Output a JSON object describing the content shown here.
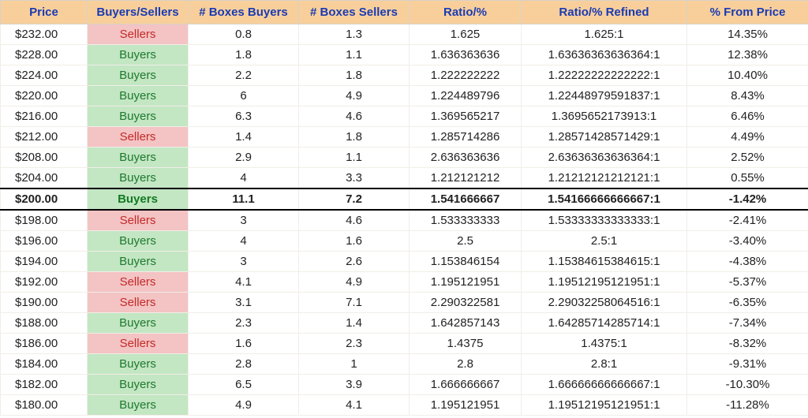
{
  "headers": {
    "price": "Price",
    "buyers_sellers": "Buyers/Sellers",
    "boxes_buyers": "# Boxes Buyers",
    "boxes_sellers": "# Boxes Sellers",
    "ratio": "Ratio/%",
    "ratio_refined": "Ratio/% Refined",
    "from_price": "% From Price"
  },
  "rows": [
    {
      "price": "$232.00",
      "side": "Sellers",
      "boxes_buyers": "0.8",
      "boxes_sellers": "1.3",
      "ratio": "1.625",
      "ratio_refined": "1.625:1",
      "from_price": "14.35%",
      "highlight": false
    },
    {
      "price": "$228.00",
      "side": "Buyers",
      "boxes_buyers": "1.8",
      "boxes_sellers": "1.1",
      "ratio": "1.636363636",
      "ratio_refined": "1.63636363636364:1",
      "from_price": "12.38%",
      "highlight": false
    },
    {
      "price": "$224.00",
      "side": "Buyers",
      "boxes_buyers": "2.2",
      "boxes_sellers": "1.8",
      "ratio": "1.222222222",
      "ratio_refined": "1.22222222222222:1",
      "from_price": "10.40%",
      "highlight": false
    },
    {
      "price": "$220.00",
      "side": "Buyers",
      "boxes_buyers": "6",
      "boxes_sellers": "4.9",
      "ratio": "1.224489796",
      "ratio_refined": "1.22448979591837:1",
      "from_price": "8.43%",
      "highlight": false
    },
    {
      "price": "$216.00",
      "side": "Buyers",
      "boxes_buyers": "6.3",
      "boxes_sellers": "4.6",
      "ratio": "1.369565217",
      "ratio_refined": "1.3695652173913:1",
      "from_price": "6.46%",
      "highlight": false
    },
    {
      "price": "$212.00",
      "side": "Sellers",
      "boxes_buyers": "1.4",
      "boxes_sellers": "1.8",
      "ratio": "1.285714286",
      "ratio_refined": "1.28571428571429:1",
      "from_price": "4.49%",
      "highlight": false
    },
    {
      "price": "$208.00",
      "side": "Buyers",
      "boxes_buyers": "2.9",
      "boxes_sellers": "1.1",
      "ratio": "2.636363636",
      "ratio_refined": "2.63636363636364:1",
      "from_price": "2.52%",
      "highlight": false
    },
    {
      "price": "$204.00",
      "side": "Buyers",
      "boxes_buyers": "4",
      "boxes_sellers": "3.3",
      "ratio": "1.212121212",
      "ratio_refined": "1.21212121212121:1",
      "from_price": "0.55%",
      "highlight": false
    },
    {
      "price": "$200.00",
      "side": "Buyers",
      "boxes_buyers": "11.1",
      "boxes_sellers": "7.2",
      "ratio": "1.541666667",
      "ratio_refined": "1.54166666666667:1",
      "from_price": "-1.42%",
      "highlight": true
    },
    {
      "price": "$198.00",
      "side": "Sellers",
      "boxes_buyers": "3",
      "boxes_sellers": "4.6",
      "ratio": "1.533333333",
      "ratio_refined": "1.53333333333333:1",
      "from_price": "-2.41%",
      "highlight": false
    },
    {
      "price": "$196.00",
      "side": "Buyers",
      "boxes_buyers": "4",
      "boxes_sellers": "1.6",
      "ratio": "2.5",
      "ratio_refined": "2.5:1",
      "from_price": "-3.40%",
      "highlight": false
    },
    {
      "price": "$194.00",
      "side": "Buyers",
      "boxes_buyers": "3",
      "boxes_sellers": "2.6",
      "ratio": "1.153846154",
      "ratio_refined": "1.15384615384615:1",
      "from_price": "-4.38%",
      "highlight": false
    },
    {
      "price": "$192.00",
      "side": "Sellers",
      "boxes_buyers": "4.1",
      "boxes_sellers": "4.9",
      "ratio": "1.195121951",
      "ratio_refined": "1.19512195121951:1",
      "from_price": "-5.37%",
      "highlight": false
    },
    {
      "price": "$190.00",
      "side": "Sellers",
      "boxes_buyers": "3.1",
      "boxes_sellers": "7.1",
      "ratio": "2.290322581",
      "ratio_refined": "2.29032258064516:1",
      "from_price": "-6.35%",
      "highlight": false
    },
    {
      "price": "$188.00",
      "side": "Buyers",
      "boxes_buyers": "2.3",
      "boxes_sellers": "1.4",
      "ratio": "1.642857143",
      "ratio_refined": "1.64285714285714:1",
      "from_price": "-7.34%",
      "highlight": false
    },
    {
      "price": "$186.00",
      "side": "Sellers",
      "boxes_buyers": "1.6",
      "boxes_sellers": "2.3",
      "ratio": "1.4375",
      "ratio_refined": "1.4375:1",
      "from_price": "-8.32%",
      "highlight": false
    },
    {
      "price": "$184.00",
      "side": "Buyers",
      "boxes_buyers": "2.8",
      "boxes_sellers": "1",
      "ratio": "2.8",
      "ratio_refined": "2.8:1",
      "from_price": "-9.31%",
      "highlight": false
    },
    {
      "price": "$182.00",
      "side": "Buyers",
      "boxes_buyers": "6.5",
      "boxes_sellers": "3.9",
      "ratio": "1.666666667",
      "ratio_refined": "1.66666666666667:1",
      "from_price": "-10.30%",
      "highlight": false
    },
    {
      "price": "$180.00",
      "side": "Buyers",
      "boxes_buyers": "4.9",
      "boxes_sellers": "4.1",
      "ratio": "1.195121951",
      "ratio_refined": "1.19512195121951:1",
      "from_price": "-11.28%",
      "highlight": false
    }
  ]
}
